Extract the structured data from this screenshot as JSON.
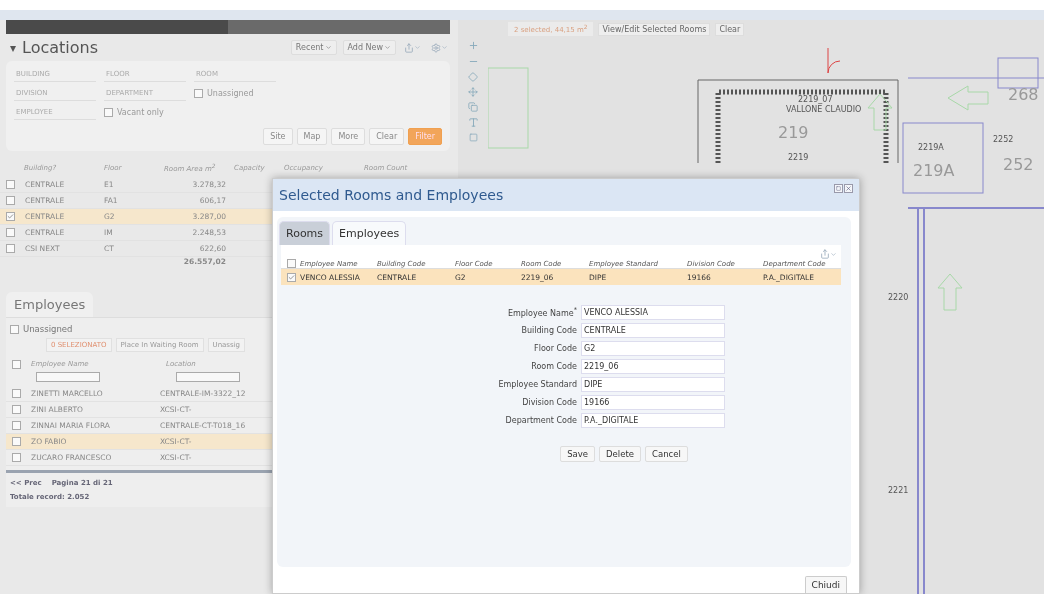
{
  "locations": {
    "title": "Locations",
    "caret": "▾",
    "expanded": true,
    "toolbar": [
      {
        "kind": "menu",
        "label": "Recent"
      },
      {
        "kind": "menu",
        "label": "Add New"
      },
      {
        "kind": "export"
      },
      {
        "kind": "settings"
      }
    ],
    "filter_rows": [
      [
        {
          "kind": "field",
          "placeholder": "BUILDING"
        },
        {
          "kind": "field",
          "placeholder": "FLOOR"
        },
        {
          "kind": "field",
          "placeholder": "ROOM"
        }
      ],
      [
        {
          "kind": "field",
          "placeholder": "DIVISION"
        },
        {
          "kind": "field",
          "placeholder": "DEPARTMENT"
        },
        {
          "kind": "checkbox",
          "label": "Unassigned",
          "checked": false
        }
      ],
      [
        {
          "kind": "field",
          "placeholder": "EMPLOYEE"
        },
        {
          "kind": "checkbox",
          "label": "Vacant only",
          "checked": false
        }
      ]
    ],
    "filter_buttons": [
      {
        "label": "Site",
        "kind": "plain"
      },
      {
        "label": "Map",
        "kind": "plain"
      },
      {
        "label": "More",
        "kind": "plain"
      },
      {
        "label": "Clear",
        "kind": "plain"
      },
      {
        "label": "Filter",
        "kind": "primary"
      }
    ],
    "columns": [
      "Building?",
      "Floor",
      "Room Area m$^{2}$",
      "Capacity",
      "Occupancy",
      "Room Count"
    ],
    "rows": [
      {
        "building": "CENTRALE",
        "floor": "E1",
        "area": "3.278,32",
        "checked": false,
        "selected": false
      },
      {
        "building": "CENTRALE",
        "floor": "FA1",
        "area": "606,17",
        "checked": false,
        "selected": false
      },
      {
        "building": "CENTRALE",
        "floor": "G2",
        "area": "3.287,00",
        "checked": true,
        "selected": true
      },
      {
        "building": "CENTRALE",
        "floor": "IM",
        "area": "2.248,53",
        "checked": false,
        "selected": false
      },
      {
        "building": "CSI NEXT",
        "floor": "CT",
        "area": "622,60",
        "checked": false,
        "selected": false
      }
    ],
    "total": "26.557,02"
  },
  "employees": {
    "tab": "Employees",
    "unassigned": {
      "label": "Unassigned",
      "checked": false
    },
    "actions": [
      {
        "label": "0 SELEZIONATO",
        "kind": "count"
      },
      {
        "label": "Place In Waiting Room",
        "kind": "plain"
      },
      {
        "label": "Unassig",
        "kind": "plain"
      }
    ],
    "columns": [
      "Employee Name",
      "Location"
    ],
    "header_checked": false,
    "rows": [
      {
        "name": "ZINETTI MARCELLO",
        "location": "CENTRALE-IM-3322_12",
        "checked": false,
        "selected": false
      },
      {
        "name": "ZINI ALBERTO",
        "location": "XCSI-CT-",
        "checked": false,
        "selected": false
      },
      {
        "name": "ZINNAI MARIA FLORA",
        "location": "CENTRALE-CT-T018_16",
        "checked": false,
        "selected": false
      },
      {
        "name": "ZO FABIO",
        "location": "XCSI-CT-",
        "checked": false,
        "selected": true
      },
      {
        "name": "ZUCARO FRANCESCO",
        "location": "XCSI-CT-",
        "checked": false,
        "selected": false
      }
    ],
    "pager": {
      "prev": "<< Prec",
      "page": "Pagina 21 di 21"
    },
    "total": "Totale record: 2.052"
  },
  "map": {
    "status": "2 selected, 44,15 m$^{2}$",
    "buttons": [
      "View/Edit Selected Rooms",
      "Clear"
    ],
    "labels": [
      {
        "text": "268",
        "kind": "big"
      },
      {
        "text": "2252",
        "kind": "small"
      },
      {
        "text": "252",
        "kind": "big"
      },
      {
        "text": "2219A",
        "kind": "small"
      },
      {
        "text": "219A",
        "kind": "big"
      },
      {
        "text": "219",
        "kind": "big"
      },
      {
        "text": "2219",
        "kind": "small"
      },
      {
        "text": "2219_07",
        "kind": "small"
      },
      {
        "text": "VALLONE CLAUDIO",
        "kind": "small"
      },
      {
        "text": "2220",
        "kind": "small"
      },
      {
        "text": "2221",
        "kind": "small"
      }
    ]
  },
  "dialog": {
    "title": "Selected Rooms and Employees",
    "tabs": [
      {
        "label": "Rooms",
        "selected": false
      },
      {
        "label": "Employees",
        "selected": true
      }
    ],
    "columns": [
      "Employee Name",
      "Building Code",
      "Floor Code",
      "Room Code",
      "Employee Standard",
      "Division Code",
      "Department Code"
    ],
    "header_checked": false,
    "rows": [
      {
        "cells": [
          "VENCO ALESSIA",
          "CENTRALE",
          "G2",
          "2219_06",
          "DIPE",
          "19166",
          "P.A._DIGITALE"
        ],
        "checked": true,
        "selected": true
      }
    ],
    "form": [
      {
        "label": "Employee Name$^{*}$",
        "value": "VENCO ALESSIA"
      },
      {
        "label": "Building Code",
        "value": "CENTRALE"
      },
      {
        "label": "Floor Code",
        "value": "G2"
      },
      {
        "label": "Room Code",
        "value": "2219_06"
      },
      {
        "label": "Employee Standard",
        "value": "DIPE"
      },
      {
        "label": "Division Code",
        "value": "19166"
      },
      {
        "label": "Department Code",
        "value": "P.A._DIGITALE"
      }
    ],
    "actions": [
      "Save",
      "Delete",
      "Cancel"
    ],
    "close_button": "Chiudi"
  }
}
